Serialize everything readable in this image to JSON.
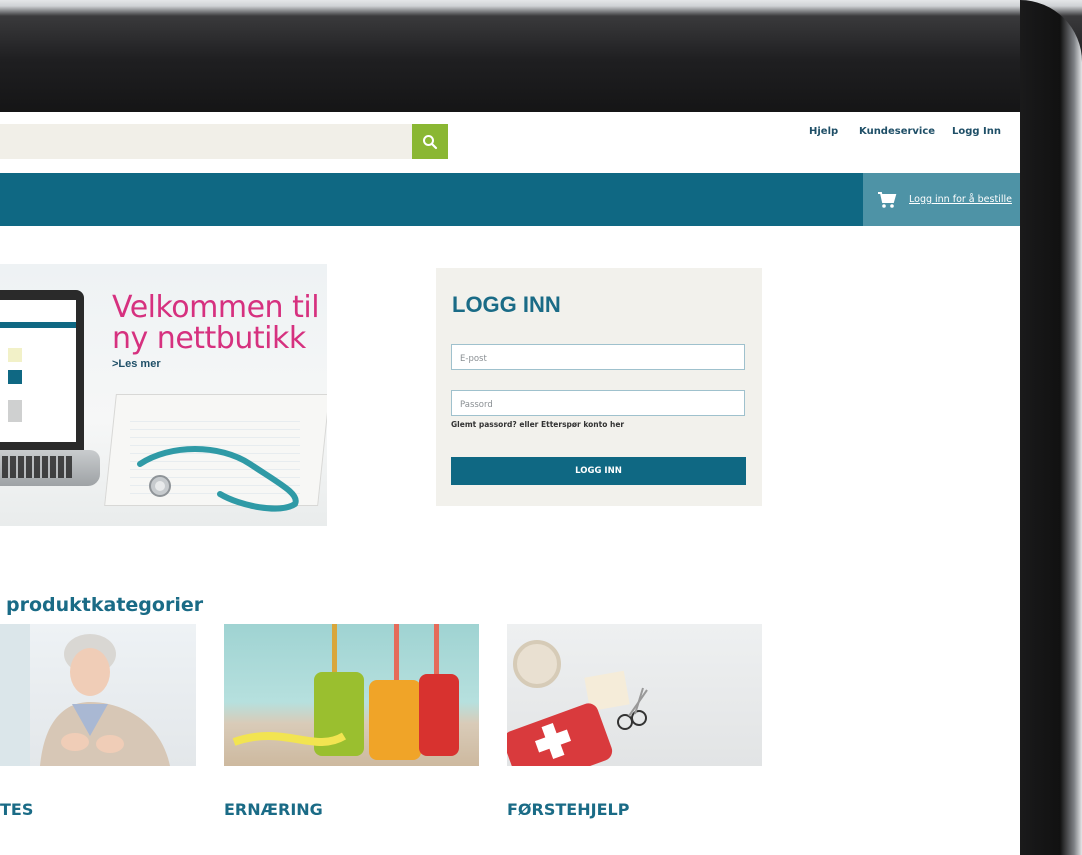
{
  "header": {
    "search_placeholder": "",
    "links": [
      "Hjelp",
      "Kundeservice",
      "Logg Inn"
    ]
  },
  "navbar": {
    "cart_link": "Logg inn for å bestille"
  },
  "banner": {
    "title_line1": "Velkommen til",
    "title_line2": "ny nettbutikk",
    "link": ">Les mer"
  },
  "login": {
    "title": "LOGG INN",
    "email_placeholder": "E-post",
    "password_placeholder": "Passord",
    "forgot_text": "Glemt passord? eller Etterspør konto her",
    "button": "LOGG INN"
  },
  "categories": {
    "heading": "produktkategorier",
    "items": [
      "TES",
      "ERNÆRING",
      "FØRSTEHJELP"
    ]
  },
  "colors": {
    "brand_teal": "#0f6883",
    "accent_pink": "#d6317f",
    "search_green": "#8ab733",
    "login_bg": "#f2f1ec"
  }
}
